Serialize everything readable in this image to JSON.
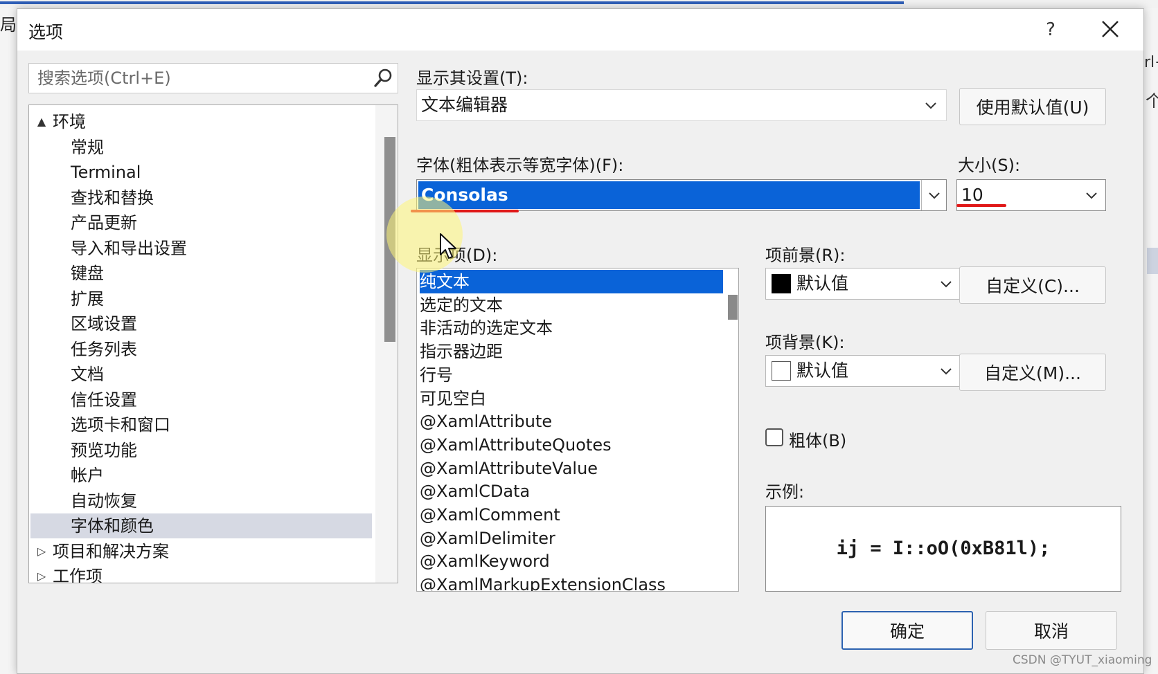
{
  "background": {
    "left_char": "局",
    "right_text": "rl+",
    "right_char": "个"
  },
  "dialog": {
    "title": "选项",
    "help": "?",
    "search_placeholder": "搜索选项(Ctrl+E)",
    "tree": [
      {
        "label": "环境",
        "expander": "▲",
        "level": 0
      },
      {
        "label": "常规",
        "level": 1
      },
      {
        "label": "Terminal",
        "level": 1
      },
      {
        "label": "查找和替换",
        "level": 1
      },
      {
        "label": "产品更新",
        "level": 1
      },
      {
        "label": "导入和导出设置",
        "level": 1
      },
      {
        "label": "键盘",
        "level": 1
      },
      {
        "label": "扩展",
        "level": 1
      },
      {
        "label": "区域设置",
        "level": 1
      },
      {
        "label": "任务列表",
        "level": 1
      },
      {
        "label": "文档",
        "level": 1
      },
      {
        "label": "信任设置",
        "level": 1
      },
      {
        "label": "选项卡和窗口",
        "level": 1
      },
      {
        "label": "预览功能",
        "level": 1
      },
      {
        "label": "帐户",
        "level": 1
      },
      {
        "label": "自动恢复",
        "level": 1
      },
      {
        "label": "字体和颜色",
        "level": 1,
        "selected": true
      },
      {
        "label": "项目和解决方案",
        "expander": "▷",
        "level": 0
      },
      {
        "label": "工作项",
        "expander": "▷",
        "level": 0
      }
    ],
    "show_settings_label": "显示其设置(T):",
    "show_settings_value": "文本编辑器",
    "use_defaults_button": "使用默认值(U)",
    "font_label": "字体(粗体表示等宽字体)(F):",
    "font_value": "Consolas",
    "size_label": "大小(S):",
    "size_value": "10",
    "display_items_label": "显示项(D):",
    "display_items": [
      "纯文本",
      "选定的文本",
      "非活动的选定文本",
      "指示器边距",
      "行号",
      "可见空白",
      "@XamlAttribute",
      "@XamlAttributeQuotes",
      "@XamlAttributeValue",
      "@XamlCData",
      "@XamlComment",
      "@XamlDelimiter",
      "@XamlKeyword",
      "@XamlMarkupExtensionClass"
    ],
    "item_foreground_label": "项前景(R):",
    "item_foreground_value": "默认值",
    "item_foreground_swatch": "#000000",
    "customize_fg_button": "自定义(C)...",
    "item_background_label": "项背景(K):",
    "item_background_value": "默认值",
    "item_background_swatch": "#ffffff",
    "customize_bg_button": "自定义(M)...",
    "bold_label": "粗体(B)",
    "sample_label": "示例:",
    "sample_text": "ij = I::oO(0xB81l);",
    "ok_button": "确定",
    "cancel_button": "取消"
  },
  "watermark": "CSDN @TYUT_xiaoming",
  "colors": {
    "accent": "#0a63d8",
    "annotation_red": "#e01818",
    "primary_border": "#2c62b0"
  }
}
